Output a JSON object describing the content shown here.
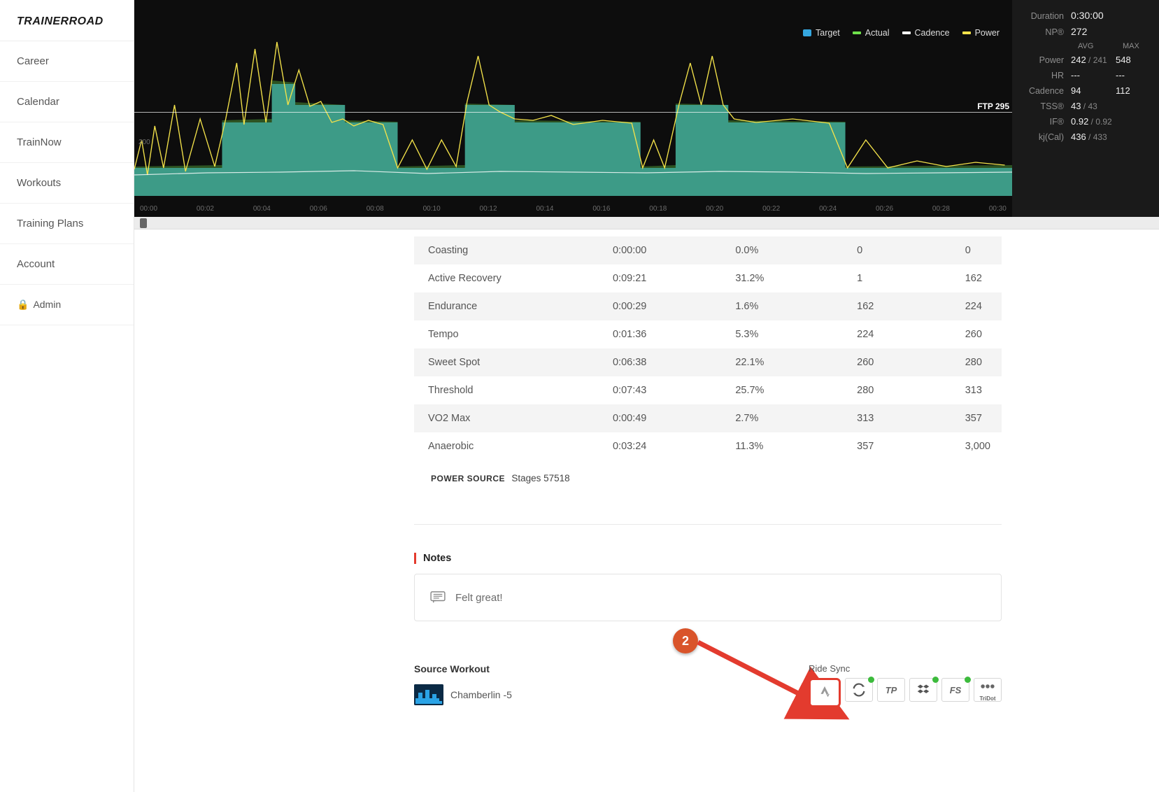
{
  "brand": "TRAINERROAD",
  "nav": {
    "career": "Career",
    "calendar": "Calendar",
    "trainnow": "TrainNow",
    "workouts": "Workouts",
    "plans": "Training Plans",
    "account": "Account",
    "admin": "Admin"
  },
  "legend": {
    "target": "Target",
    "actual": "Actual",
    "cadence": "Cadence",
    "power": "Power"
  },
  "ftp_label": "FTP 295",
  "y_tick": "200",
  "time_ticks": [
    "00:00",
    "00:02",
    "00:04",
    "00:06",
    "00:08",
    "00:10",
    "00:12",
    "00:14",
    "00:16",
    "00:18",
    "00:20",
    "00:22",
    "00:24",
    "00:26",
    "00:28",
    "00:30"
  ],
  "stats": {
    "duration_label": "Duration",
    "duration": "0:30:00",
    "np_label": "NP®",
    "np": "272",
    "avg_head": "AVG",
    "max_head": "MAX",
    "power_label": "Power",
    "power_avg": "242",
    "power_avg_sub": " / 241",
    "power_max": "548",
    "hr_label": "HR",
    "hr_avg": "---",
    "hr_max": "---",
    "cadence_label": "Cadence",
    "cadence_avg": "94",
    "cadence_max": "112",
    "tss_label": "TSS®",
    "tss": "43",
    "tss_sub": " / 43",
    "if_label": "IF®",
    "if": "0.92",
    "if_sub": " / 0.92",
    "kj_label": "kj(Cal)",
    "kj": "436",
    "kj_sub": " / 433"
  },
  "zones": [
    {
      "name": "Coasting",
      "time": "0:00:00",
      "pct": "0.0%",
      "lo": "0",
      "hi": "0"
    },
    {
      "name": "Active Recovery",
      "time": "0:09:21",
      "pct": "31.2%",
      "lo": "1",
      "hi": "162"
    },
    {
      "name": "Endurance",
      "time": "0:00:29",
      "pct": "1.6%",
      "lo": "162",
      "hi": "224"
    },
    {
      "name": "Tempo",
      "time": "0:01:36",
      "pct": "5.3%",
      "lo": "224",
      "hi": "260"
    },
    {
      "name": "Sweet Spot",
      "time": "0:06:38",
      "pct": "22.1%",
      "lo": "260",
      "hi": "280"
    },
    {
      "name": "Threshold",
      "time": "0:07:43",
      "pct": "25.7%",
      "lo": "280",
      "hi": "313"
    },
    {
      "name": "VO2 Max",
      "time": "0:00:49",
      "pct": "2.7%",
      "lo": "313",
      "hi": "357"
    },
    {
      "name": "Anaerobic",
      "time": "0:03:24",
      "pct": "11.3%",
      "lo": "357",
      "hi": "3,000"
    }
  ],
  "power_source": {
    "label": "POWER SOURCE",
    "value": "Stages 57518"
  },
  "notes": {
    "head": "Notes",
    "text": "Felt great!"
  },
  "source_workout": {
    "head": "Source Workout",
    "name": "Chamberlin -5"
  },
  "ride_sync": {
    "head": "Ride Sync",
    "tp": "TP",
    "fs": "FS",
    "tridot": "TriDot"
  },
  "annotation": {
    "badge": "2"
  },
  "chart_data": {
    "type": "line",
    "x_range_minutes": [
      0,
      30
    ],
    "ftp": 295,
    "target_intervals_watts": [
      {
        "start": 0,
        "end": 3,
        "watts": 155
      },
      {
        "start": 3,
        "end": 4.7,
        "watts": 280
      },
      {
        "start": 4.7,
        "end": 5.5,
        "watts": 360
      },
      {
        "start": 5.5,
        "end": 7.2,
        "watts": 310
      },
      {
        "start": 7.2,
        "end": 9,
        "watts": 280
      },
      {
        "start": 9,
        "end": 11.3,
        "watts": 155
      },
      {
        "start": 11.3,
        "end": 13,
        "watts": 310
      },
      {
        "start": 13,
        "end": 17.3,
        "watts": 280
      },
      {
        "start": 17.3,
        "end": 18.5,
        "watts": 155
      },
      {
        "start": 18.5,
        "end": 20.3,
        "watts": 310
      },
      {
        "start": 20.3,
        "end": 24.3,
        "watts": 280
      },
      {
        "start": 24.3,
        "end": 30,
        "watts": 155
      }
    ],
    "cadence_avg_rpm": 94,
    "series_legend": [
      "Target",
      "Actual",
      "Cadence",
      "Power"
    ]
  }
}
